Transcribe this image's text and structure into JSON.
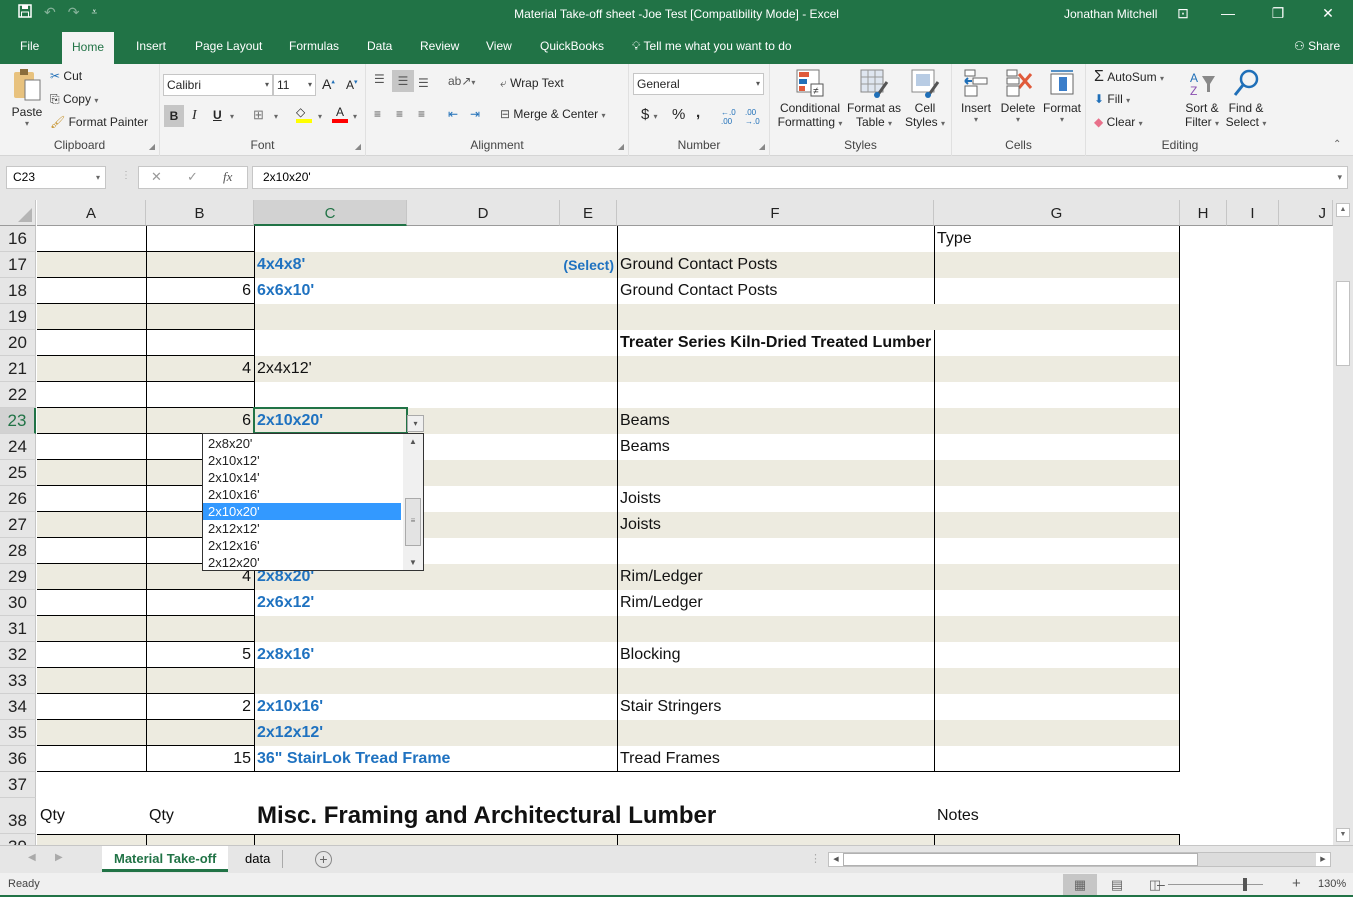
{
  "window": {
    "title": "Material Take-off sheet -Joe Test  [Compatibility Mode]  -  Excel",
    "user": "Jonathan Mitchell",
    "controls": {
      "ribbon_options": "ribbon-display-options-icon",
      "minimize": "minimize-icon",
      "restore": "restore-icon",
      "close": "close-icon"
    }
  },
  "qat": {
    "save": "save-icon",
    "undo": "undo-icon",
    "redo": "redo-icon",
    "customize": "customize-qat-icon"
  },
  "ribbon_tabs": [
    "File",
    "Home",
    "Insert",
    "Page Layout",
    "Formulas",
    "Data",
    "Review",
    "View",
    "QuickBooks"
  ],
  "active_tab": "Home",
  "tell_me": "Tell me what you want to do",
  "share": "Share",
  "ribbon": {
    "clipboard": {
      "label": "Clipboard",
      "paste": "Paste",
      "cut": "Cut",
      "copy": "Copy",
      "format_painter": "Format Painter"
    },
    "font": {
      "label": "Font",
      "font_name": "Calibri",
      "font_size": "11",
      "bold": "B",
      "italic": "I",
      "underline": "U",
      "fill_color": "#ffff00",
      "font_color": "#ff0000"
    },
    "alignment": {
      "label": "Alignment",
      "wrap_text": "Wrap Text",
      "merge_center": "Merge & Center"
    },
    "number": {
      "label": "Number",
      "format": "General",
      "currency": "$",
      "percent": "%",
      "comma": ",",
      "inc_decimal": ".00",
      "dec_decimal": ".0"
    },
    "styles": {
      "label": "Styles",
      "conditional_formatting": [
        "Conditional",
        "Formatting"
      ],
      "format_as_table": [
        "Format as",
        "Table"
      ],
      "cell_styles": [
        "Cell",
        "Styles"
      ]
    },
    "cells": {
      "label": "Cells",
      "insert": "Insert",
      "delete": "Delete",
      "format": "Format"
    },
    "editing": {
      "label": "Editing",
      "autosum": "AutoSum",
      "fill": "Fill",
      "clear": "Clear",
      "sort_filter": [
        "Sort &",
        "Filter"
      ],
      "find_select": [
        "Find &",
        "Select"
      ]
    }
  },
  "formula_bar": {
    "name_box": "C23",
    "cancel": "✕",
    "enter": "✓",
    "fx": "fx",
    "formula": "2x10x20'"
  },
  "columns": [
    "A",
    "B",
    "C",
    "D",
    "E",
    "F",
    "G",
    "H",
    "I",
    "J"
  ],
  "selected_column": "C",
  "selected_row": "23",
  "rows": [
    {
      "n": "16",
      "alt": false,
      "a": "",
      "b": "",
      "c": "",
      "c_style": "",
      "e": "",
      "f": "",
      "f_style": "",
      "g": "Type"
    },
    {
      "n": "17",
      "alt": true,
      "a": "",
      "b": "",
      "c": "4x4x8'",
      "c_style": "blue",
      "e": "(Select)",
      "f": "Ground Contact Posts",
      "f_style": "",
      "g": ""
    },
    {
      "n": "18",
      "alt": false,
      "a": "",
      "b": "6",
      "c": "6x6x10'",
      "c_style": "blue",
      "e": "",
      "f": "Ground Contact Posts",
      "f_style": "",
      "g": ""
    },
    {
      "n": "19",
      "alt": true,
      "a": "",
      "b": "",
      "c": "",
      "c_style": "",
      "e": "",
      "f": "",
      "f_style": "",
      "g": ""
    },
    {
      "n": "20",
      "alt": false,
      "a": "",
      "b": "",
      "c": "",
      "c_style": "",
      "e": "",
      "f": "Treater Series Kiln-Dried Treated Lumber",
      "f_style": "bold",
      "g": ""
    },
    {
      "n": "21",
      "alt": true,
      "a": "",
      "b": "4",
      "c": "2x4x12'",
      "c_style": "",
      "e": "",
      "f": "",
      "f_style": "",
      "g": ""
    },
    {
      "n": "22",
      "alt": false,
      "a": "",
      "b": "",
      "c": "",
      "c_style": "",
      "e": "",
      "f": "",
      "f_style": "",
      "g": ""
    },
    {
      "n": "23",
      "alt": true,
      "a": "",
      "b": "6",
      "c": "2x10x20'",
      "c_style": "blue",
      "e": "",
      "f": "Beams",
      "f_style": "",
      "g": ""
    },
    {
      "n": "24",
      "alt": false,
      "a": "",
      "b": "",
      "c": "",
      "c_style": "",
      "e": "",
      "f": "Beams",
      "f_style": "",
      "g": ""
    },
    {
      "n": "25",
      "alt": true,
      "a": "",
      "b": "",
      "c": "",
      "c_style": "",
      "e": "",
      "f": "",
      "f_style": "",
      "g": ""
    },
    {
      "n": "26",
      "alt": false,
      "a": "",
      "b": "",
      "c": "",
      "c_style": "",
      "e": "",
      "f": "Joists",
      "f_style": "",
      "g": ""
    },
    {
      "n": "27",
      "alt": true,
      "a": "",
      "b": "",
      "c": "",
      "c_style": "",
      "e": "",
      "f": "Joists",
      "f_style": "",
      "g": ""
    },
    {
      "n": "28",
      "alt": false,
      "a": "",
      "b": "",
      "c": "",
      "c_style": "",
      "e": "",
      "f": "",
      "f_style": "",
      "g": ""
    },
    {
      "n": "29",
      "alt": true,
      "a": "",
      "b": "4",
      "c": "2x8x20'",
      "c_style": "blue",
      "e": "",
      "f": "Rim/Ledger",
      "f_style": "",
      "g": ""
    },
    {
      "n": "30",
      "alt": false,
      "a": "",
      "b": "",
      "c": "2x6x12'",
      "c_style": "blue",
      "e": "",
      "f": "Rim/Ledger",
      "f_style": "",
      "g": ""
    },
    {
      "n": "31",
      "alt": true,
      "a": "",
      "b": "",
      "c": "",
      "c_style": "",
      "e": "",
      "f": "",
      "f_style": "",
      "g": ""
    },
    {
      "n": "32",
      "alt": false,
      "a": "",
      "b": "5",
      "c": "2x8x16'",
      "c_style": "blue",
      "e": "",
      "f": "Blocking",
      "f_style": "",
      "g": ""
    },
    {
      "n": "33",
      "alt": true,
      "a": "",
      "b": "",
      "c": "",
      "c_style": "",
      "e": "",
      "f": "",
      "f_style": "",
      "g": ""
    },
    {
      "n": "34",
      "alt": false,
      "a": "",
      "b": "2",
      "c": "2x10x16'",
      "c_style": "blue",
      "e": "",
      "f": "Stair Stringers",
      "f_style": "",
      "g": ""
    },
    {
      "n": "35",
      "alt": true,
      "a": "",
      "b": "",
      "c": "2x12x12'",
      "c_style": "blue",
      "e": "",
      "f": "",
      "f_style": "",
      "g": ""
    },
    {
      "n": "36",
      "alt": false,
      "a": "",
      "b": "15",
      "c": "36\" StairLok Tread Frame",
      "c_style": "blue",
      "e": "",
      "f": "Tread Frames",
      "f_style": "",
      "g": ""
    }
  ],
  "row37": {
    "n": "37"
  },
  "row38": {
    "n": "38",
    "a": "Qty",
    "b": "Qty",
    "c": "Misc. Framing and Architectural Lumber",
    "g": "Notes"
  },
  "row39": {
    "n": "39"
  },
  "dropdown": {
    "options": [
      "2x8x20'",
      "2x10x12'",
      "2x10x14'",
      "2x10x16'",
      "2x10x20'",
      "2x12x12'",
      "2x12x16'",
      "2x12x20'"
    ],
    "selected": "2x10x20'"
  },
  "sheets": [
    "Material Take-off",
    "data"
  ],
  "active_sheet": "Material Take-off",
  "status": {
    "ready": "Ready",
    "zoom": "130%",
    "zoom_value_percent": 130
  }
}
